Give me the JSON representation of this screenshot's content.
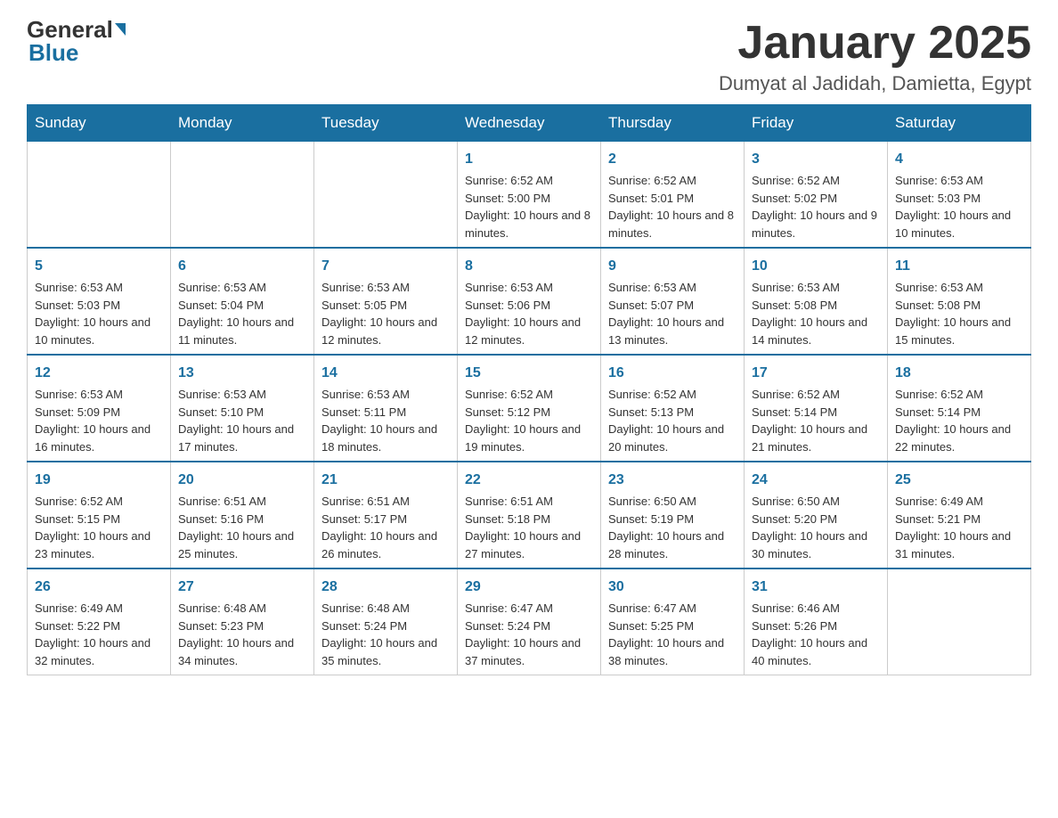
{
  "header": {
    "logo_general": "General",
    "logo_blue": "Blue",
    "title": "January 2025",
    "subtitle": "Dumyat al Jadidah, Damietta, Egypt"
  },
  "days_of_week": [
    "Sunday",
    "Monday",
    "Tuesday",
    "Wednesday",
    "Thursday",
    "Friday",
    "Saturday"
  ],
  "weeks": [
    {
      "days": [
        {
          "number": "",
          "info": ""
        },
        {
          "number": "",
          "info": ""
        },
        {
          "number": "",
          "info": ""
        },
        {
          "number": "1",
          "info": "Sunrise: 6:52 AM\nSunset: 5:00 PM\nDaylight: 10 hours and 8 minutes."
        },
        {
          "number": "2",
          "info": "Sunrise: 6:52 AM\nSunset: 5:01 PM\nDaylight: 10 hours and 8 minutes."
        },
        {
          "number": "3",
          "info": "Sunrise: 6:52 AM\nSunset: 5:02 PM\nDaylight: 10 hours and 9 minutes."
        },
        {
          "number": "4",
          "info": "Sunrise: 6:53 AM\nSunset: 5:03 PM\nDaylight: 10 hours and 10 minutes."
        }
      ]
    },
    {
      "days": [
        {
          "number": "5",
          "info": "Sunrise: 6:53 AM\nSunset: 5:03 PM\nDaylight: 10 hours and 10 minutes."
        },
        {
          "number": "6",
          "info": "Sunrise: 6:53 AM\nSunset: 5:04 PM\nDaylight: 10 hours and 11 minutes."
        },
        {
          "number": "7",
          "info": "Sunrise: 6:53 AM\nSunset: 5:05 PM\nDaylight: 10 hours and 12 minutes."
        },
        {
          "number": "8",
          "info": "Sunrise: 6:53 AM\nSunset: 5:06 PM\nDaylight: 10 hours and 12 minutes."
        },
        {
          "number": "9",
          "info": "Sunrise: 6:53 AM\nSunset: 5:07 PM\nDaylight: 10 hours and 13 minutes."
        },
        {
          "number": "10",
          "info": "Sunrise: 6:53 AM\nSunset: 5:08 PM\nDaylight: 10 hours and 14 minutes."
        },
        {
          "number": "11",
          "info": "Sunrise: 6:53 AM\nSunset: 5:08 PM\nDaylight: 10 hours and 15 minutes."
        }
      ]
    },
    {
      "days": [
        {
          "number": "12",
          "info": "Sunrise: 6:53 AM\nSunset: 5:09 PM\nDaylight: 10 hours and 16 minutes."
        },
        {
          "number": "13",
          "info": "Sunrise: 6:53 AM\nSunset: 5:10 PM\nDaylight: 10 hours and 17 minutes."
        },
        {
          "number": "14",
          "info": "Sunrise: 6:53 AM\nSunset: 5:11 PM\nDaylight: 10 hours and 18 minutes."
        },
        {
          "number": "15",
          "info": "Sunrise: 6:52 AM\nSunset: 5:12 PM\nDaylight: 10 hours and 19 minutes."
        },
        {
          "number": "16",
          "info": "Sunrise: 6:52 AM\nSunset: 5:13 PM\nDaylight: 10 hours and 20 minutes."
        },
        {
          "number": "17",
          "info": "Sunrise: 6:52 AM\nSunset: 5:14 PM\nDaylight: 10 hours and 21 minutes."
        },
        {
          "number": "18",
          "info": "Sunrise: 6:52 AM\nSunset: 5:14 PM\nDaylight: 10 hours and 22 minutes."
        }
      ]
    },
    {
      "days": [
        {
          "number": "19",
          "info": "Sunrise: 6:52 AM\nSunset: 5:15 PM\nDaylight: 10 hours and 23 minutes."
        },
        {
          "number": "20",
          "info": "Sunrise: 6:51 AM\nSunset: 5:16 PM\nDaylight: 10 hours and 25 minutes."
        },
        {
          "number": "21",
          "info": "Sunrise: 6:51 AM\nSunset: 5:17 PM\nDaylight: 10 hours and 26 minutes."
        },
        {
          "number": "22",
          "info": "Sunrise: 6:51 AM\nSunset: 5:18 PM\nDaylight: 10 hours and 27 minutes."
        },
        {
          "number": "23",
          "info": "Sunrise: 6:50 AM\nSunset: 5:19 PM\nDaylight: 10 hours and 28 minutes."
        },
        {
          "number": "24",
          "info": "Sunrise: 6:50 AM\nSunset: 5:20 PM\nDaylight: 10 hours and 30 minutes."
        },
        {
          "number": "25",
          "info": "Sunrise: 6:49 AM\nSunset: 5:21 PM\nDaylight: 10 hours and 31 minutes."
        }
      ]
    },
    {
      "days": [
        {
          "number": "26",
          "info": "Sunrise: 6:49 AM\nSunset: 5:22 PM\nDaylight: 10 hours and 32 minutes."
        },
        {
          "number": "27",
          "info": "Sunrise: 6:48 AM\nSunset: 5:23 PM\nDaylight: 10 hours and 34 minutes."
        },
        {
          "number": "28",
          "info": "Sunrise: 6:48 AM\nSunset: 5:24 PM\nDaylight: 10 hours and 35 minutes."
        },
        {
          "number": "29",
          "info": "Sunrise: 6:47 AM\nSunset: 5:24 PM\nDaylight: 10 hours and 37 minutes."
        },
        {
          "number": "30",
          "info": "Sunrise: 6:47 AM\nSunset: 5:25 PM\nDaylight: 10 hours and 38 minutes."
        },
        {
          "number": "31",
          "info": "Sunrise: 6:46 AM\nSunset: 5:26 PM\nDaylight: 10 hours and 40 minutes."
        },
        {
          "number": "",
          "info": ""
        }
      ]
    }
  ]
}
